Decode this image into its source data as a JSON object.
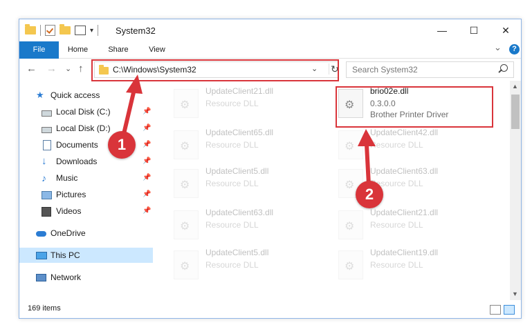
{
  "window": {
    "title": "System32",
    "min_glyph": "—",
    "max_glyph": "☐",
    "close_glyph": "✕"
  },
  "ribbon": {
    "tabs": [
      "File",
      "Home",
      "Share",
      "View"
    ],
    "collapse_glyph": "⌄",
    "help_glyph": "?"
  },
  "nav": {
    "back_glyph": "←",
    "forward_glyph": "→",
    "recent_glyph": "⌄",
    "up_glyph": "↑",
    "address": "C:\\Windows\\System32",
    "address_chevron": "⌄",
    "refresh_glyph": "↻",
    "search_placeholder": "Search System32"
  },
  "sidebar": {
    "pin_glyph": "📌",
    "items": [
      {
        "label": "Quick access",
        "icon": "star-icon"
      },
      {
        "label": "Local Disk (C:)",
        "icon": "drive-icon"
      },
      {
        "label": "Local Disk (D:)",
        "icon": "drive-icon"
      },
      {
        "label": "Documents",
        "icon": "documents-icon"
      },
      {
        "label": "Downloads",
        "icon": "downloads-icon"
      },
      {
        "label": "Music",
        "icon": "music-icon"
      },
      {
        "label": "Pictures",
        "icon": "pictures-icon"
      },
      {
        "label": "Videos",
        "icon": "videos-icon"
      },
      {
        "label": "OneDrive",
        "icon": "cloud-icon"
      },
      {
        "label": "This PC",
        "icon": "pc-icon"
      },
      {
        "label": "Network",
        "icon": "network-icon"
      }
    ]
  },
  "files": [
    {
      "name": "UpdateClient21.dll",
      "type": "Resource DLL"
    },
    {
      "name": "brio02e.dll",
      "version": "0.3.0.0",
      "description": "Brother Printer Driver"
    },
    {
      "name": "UpdateClient65.dll",
      "type": "Resource DLL"
    },
    {
      "name": "UpdateClient42.dll",
      "type": "Resource DLL"
    },
    {
      "name": "UpdateClient5.dll",
      "type": "Resource DLL"
    },
    {
      "name": "UpdateClient63.dll",
      "type": "Resource DLL"
    },
    {
      "name": "UpdateClient63.dll",
      "type": "Resource DLL"
    },
    {
      "name": "UpdateClient21.dll",
      "type": "Resource DLL"
    },
    {
      "name": "UpdateClient5.dll",
      "type": "Resource DLL"
    },
    {
      "name": "UpdateClient19.dll",
      "type": "Resource DLL"
    }
  ],
  "status": {
    "item_count": "169 items"
  },
  "annotations": {
    "step1": "1",
    "step2": "2",
    "color": "#d9343a"
  },
  "colors": {
    "accent": "#1979ca",
    "selection": "#cce8ff"
  }
}
